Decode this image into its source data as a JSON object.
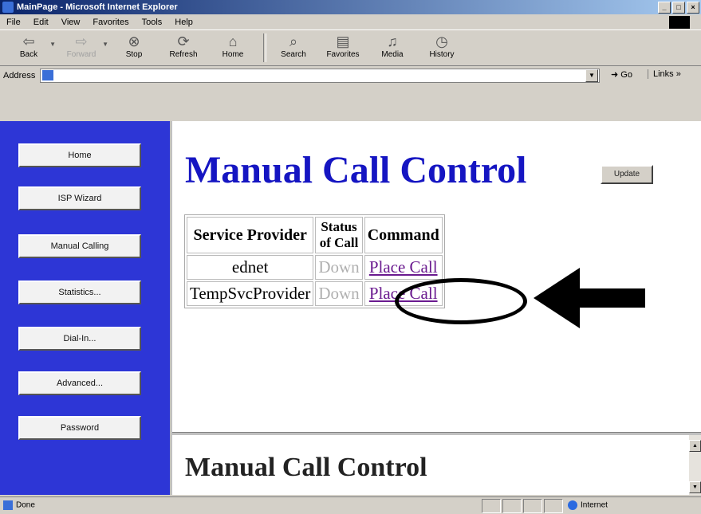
{
  "window": {
    "title": "MainPage - Microsoft Internet Explorer",
    "controls": [
      "_",
      "□",
      "×"
    ]
  },
  "menubar": {
    "items": [
      "File",
      "Edit",
      "View",
      "Favorites",
      "Tools",
      "Help"
    ]
  },
  "toolbar": {
    "back": "Back",
    "forward": "Forward",
    "stop": "Stop",
    "refresh": "Refresh",
    "home": "Home",
    "search": "Search",
    "favorites": "Favorites",
    "media": "Media",
    "history": "History"
  },
  "address": {
    "label": "Address",
    "value": "",
    "go": "Go",
    "links": "Links »"
  },
  "sidebar": {
    "items": [
      {
        "label": "Home"
      },
      {
        "label": "ISP Wizard"
      },
      {
        "label": "Manual Calling"
      },
      {
        "label": "Statistics..."
      },
      {
        "label": "Dial-In..."
      },
      {
        "label": "Advanced..."
      },
      {
        "label": "Password"
      }
    ]
  },
  "main": {
    "title": "Manual Call Control",
    "update_button": "Update",
    "table": {
      "headers": {
        "provider": "Service Provider",
        "status_line1": "Status",
        "status_line2": "of Call",
        "command": "Command"
      },
      "rows": [
        {
          "provider": "ednet",
          "status": "Down",
          "command": "Place Call"
        },
        {
          "provider": "TempSvcProvider",
          "status": "Down",
          "command": "Place Call"
        }
      ]
    }
  },
  "lower_frame": {
    "title": "Manual Call Control"
  },
  "statusbar": {
    "text": "Done",
    "zone": "Internet"
  },
  "colors": {
    "sidebar": "#2d36d6",
    "title": "#1515c2",
    "link": "#6a1a8f",
    "status_down": "#b0b0b0"
  }
}
